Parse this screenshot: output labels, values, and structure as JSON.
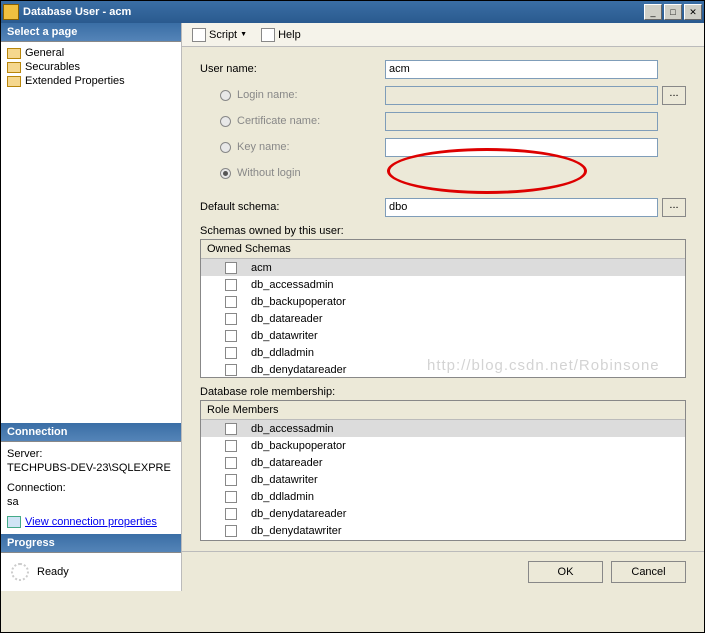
{
  "window": {
    "title": "Database User - acm"
  },
  "sidebar": {
    "select_page": "Select a page",
    "items": [
      {
        "label": "General"
      },
      {
        "label": "Securables"
      },
      {
        "label": "Extended Properties"
      }
    ],
    "connection_header": "Connection",
    "server_label": "Server:",
    "server_value": "TECHPUBS-DEV-23\\SQLEXPRE",
    "connection_label": "Connection:",
    "connection_value": "sa",
    "view_props": "View connection properties",
    "progress_header": "Progress",
    "progress_status": "Ready"
  },
  "toolbar": {
    "script": "Script",
    "help": "Help"
  },
  "form": {
    "user_name_label": "User name:",
    "user_name_value": "acm",
    "login_name_label": "Login name:",
    "cert_name_label": "Certificate name:",
    "key_name_label": "Key name:",
    "without_login_label": "Without login",
    "default_schema_label": "Default schema:",
    "default_schema_value": "dbo"
  },
  "schemas": {
    "label": "Schemas owned by this user:",
    "header": "Owned Schemas",
    "items": [
      "acm",
      "db_accessadmin",
      "db_backupoperator",
      "db_datareader",
      "db_datawriter",
      "db_ddladmin",
      "db_denydatareader"
    ]
  },
  "roles": {
    "label": "Database role membership:",
    "header": "Role Members",
    "items": [
      "db_accessadmin",
      "db_backupoperator",
      "db_datareader",
      "db_datawriter",
      "db_ddladmin",
      "db_denydatareader",
      "db_denydatawriter"
    ]
  },
  "buttons": {
    "ok": "OK",
    "cancel": "Cancel"
  },
  "watermark": "http://blog.csdn.net/Robinsone"
}
